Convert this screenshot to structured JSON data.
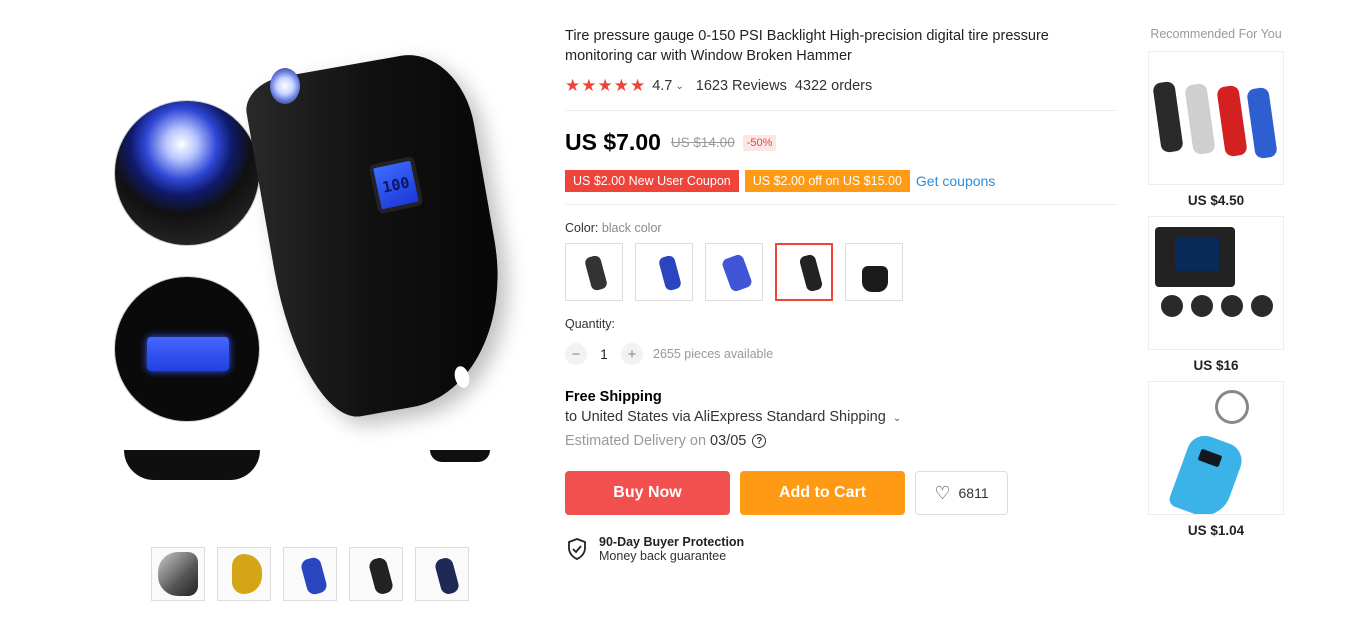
{
  "gallery": {
    "screen_text": "100",
    "thumbnails": [
      "thumb-1",
      "thumb-2",
      "thumb-3",
      "thumb-4",
      "thumb-5"
    ]
  },
  "product": {
    "title": "Tire pressure gauge 0-150 PSI Backlight High-precision digital tire pressure monitoring car with Window Broken Hammer",
    "stars": "★★★★★",
    "rating": "4.7",
    "reviews": "1623 Reviews",
    "orders": "4322 orders",
    "price": "US $7.00",
    "old_price": "US $14.00",
    "discount": "-50%",
    "coupons": [
      {
        "label": "US $2.00 New User Coupon",
        "color": "#f0443b"
      },
      {
        "label": "US $2.00 off on US $15.00",
        "color": "#ff9a14"
      }
    ],
    "get_coupons": "Get coupons",
    "color_label": "Color:",
    "color_value": "black color",
    "quantity_label": "Quantity:",
    "quantity": "1",
    "minus": "−",
    "plus": "+",
    "available": "2655 pieces available",
    "shipping_title": "Free Shipping",
    "shipping_line": "to United States via AliExpress Standard Shipping",
    "estimated_label": "Estimated Delivery on",
    "estimated_date": "03/05",
    "buy_now": "Buy Now",
    "add_to_cart": "Add to Cart",
    "wishlist_count": "6811",
    "protection_title": "90-Day Buyer Protection",
    "protection_sub": "Money back guarantee"
  },
  "recommended": {
    "title": "Recommended For You",
    "items": [
      {
        "price": "US $4.50"
      },
      {
        "price": "US $16"
      },
      {
        "price": "US $1.04"
      }
    ]
  },
  "colors": {
    "accent_red": "#f0443b",
    "accent_orange": "#ff9a14",
    "link_blue": "#2e8dd6"
  }
}
